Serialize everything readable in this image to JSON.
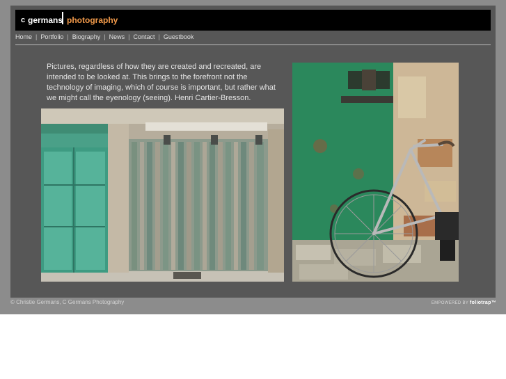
{
  "header": {
    "logo_c": "c",
    "logo_name": "germans",
    "logo_photography": "photography",
    "accent_color": "#f29a4a"
  },
  "nav": {
    "items": [
      "Home",
      "Portfolio",
      "Biography",
      "News",
      "Contact",
      "Guestbook"
    ],
    "separator": "|"
  },
  "quote": {
    "text": "Pictures, regardless of how they are created and recreated, are intended to be looked at.  This brings to the forefront not the technology of imaging, which of course is important, but rather what we might call the eyenology (seeing).  Henri Cartier-Bresson."
  },
  "photos": {
    "left": "photo-teal-doors-and-wooden-gate",
    "right": "photo-green-door-and-bicycle"
  },
  "footer": {
    "copyright": "© Christie Germans, C Germans Photography",
    "powered_prefix": "EMPOWERED BY",
    "powered_brand": "foliotrap™"
  }
}
